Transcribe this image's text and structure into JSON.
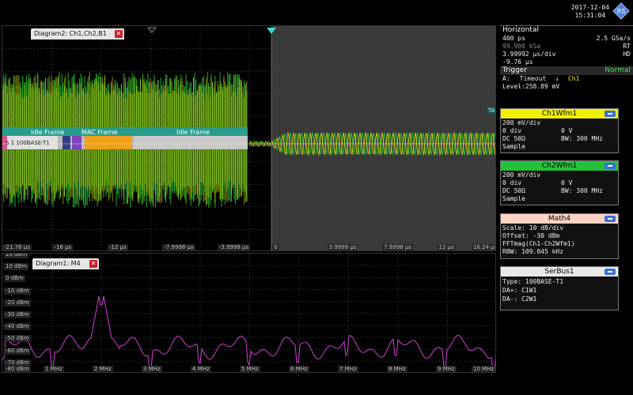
{
  "datetime": {
    "date": "2017-12-04",
    "time": "15:31:04"
  },
  "diagram2": {
    "tab_label": "Diagram2: Ch1,Ch2,B1",
    "bus_label": "S 1 100BASE-T1",
    "frames": {
      "idle1": "Idle Frame",
      "mac": "MAC Frame",
      "idle2": "Idle Frame"
    },
    "marker": "TA",
    "x_ticks": [
      "-21.76 µs",
      "-16 µs",
      "-12 µs",
      "-7.9998 µs",
      "-3.9998 µs",
      "0",
      "3.9999 µs",
      "7.9998 µs",
      "12 µs",
      "16.24 µs"
    ]
  },
  "diagram1": {
    "tab_label": "Diagram1: M4",
    "y_ticks": [
      "20 dBm",
      "10 dBm",
      "0 dBm",
      "-10 dBm",
      "-20 dBm",
      "-30 dBm",
      "-40 dBm",
      "-50 dBm",
      "-60 dBm",
      "-70 dBm",
      "-80 dBm"
    ],
    "x_ticks": [
      "1 MHz",
      "2 MHz",
      "3 MHz",
      "4 MHz",
      "5 MHz",
      "6 MHz",
      "7 MHz",
      "8 MHz",
      "9 MHz",
      "10 MHz"
    ]
  },
  "horizontal": {
    "title": "Horizontal",
    "time_scale": "400 ps",
    "sample_rate": "2.5 GSa/s",
    "record": "99.998 kSa",
    "mode_rt": "RT",
    "div": "3.99992 µs/div",
    "mode_hd": "HD",
    "offset": "-9.76 µs"
  },
  "trigger": {
    "title": "Trigger",
    "mode": "Normal",
    "source_label": "A:",
    "type": "Timeout",
    "channel": "Ch1",
    "level": "Level:258.89 mV"
  },
  "ch1": {
    "title": "Ch1Wfm1",
    "scale": "200 mV/div",
    "offset": "0 div",
    "pos": "0 V",
    "coupling": "DC 50Ω",
    "bw": "BW: 300 MHz",
    "acq": "Sample"
  },
  "ch2": {
    "title": "Ch2Wfm1",
    "scale": "200 mV/div",
    "offset": "0 div",
    "pos": "0 V",
    "coupling": "DC 50Ω",
    "bw": "BW: 300 MHz",
    "acq": "Sample"
  },
  "math4": {
    "title": "Math4",
    "scale": "Scale:  10 dB/div",
    "offset": "Offset: -30 dBm",
    "expr": "FFTmag(Ch1-Ch2Wfm1)",
    "rbw": "RBW:  109.045 kHz"
  },
  "serbus1": {
    "title": "SerBus1",
    "type": "Type: 100BASE-T1",
    "dap": "DA+: C1W1",
    "dam": "DA-:  C2W1"
  },
  "colors": {
    "ch1": "#f0f000",
    "ch2": "#22c33a",
    "math": "#ffd3c4",
    "bus": "#e8e8e8",
    "fft": "#d040d0",
    "accent": "#1fc0c0"
  }
}
